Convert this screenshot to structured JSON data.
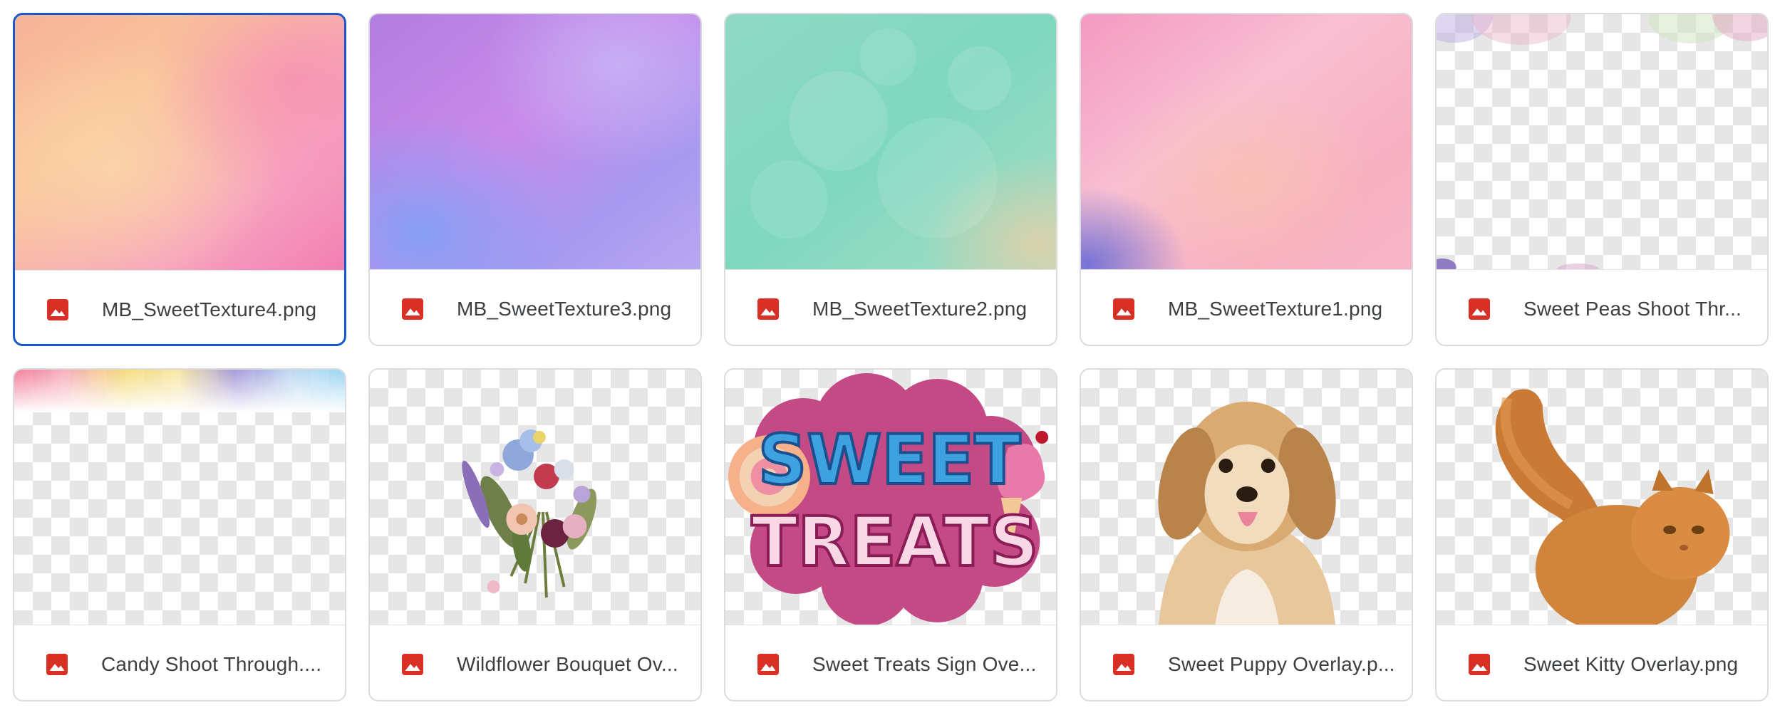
{
  "files": [
    {
      "name": "MB_SweetTexture4.png",
      "type_icon": "image-icon",
      "selected": true
    },
    {
      "name": "MB_SweetTexture3.png",
      "type_icon": "image-icon",
      "selected": false
    },
    {
      "name": "MB_SweetTexture2.png",
      "type_icon": "image-icon",
      "selected": false
    },
    {
      "name": "MB_SweetTexture1.png",
      "type_icon": "image-icon",
      "selected": false
    },
    {
      "name": "Sweet Peas Shoot Thr...",
      "type_icon": "image-icon",
      "selected": false
    },
    {
      "name": "Candy Shoot Through....",
      "type_icon": "image-icon",
      "selected": false
    },
    {
      "name": "Wildflower Bouquet Ov...",
      "type_icon": "image-icon",
      "selected": false
    },
    {
      "name": "Sweet Treats Sign Ove...",
      "type_icon": "image-icon",
      "selected": false
    },
    {
      "name": "Sweet Puppy Overlay.p...",
      "type_icon": "image-icon",
      "selected": false
    },
    {
      "name": "Sweet Kitty Overlay.png",
      "type_icon": "image-icon",
      "selected": false
    }
  ],
  "thumbnails": {
    "sign_line1": "SWEET",
    "sign_line2": "TREATS"
  },
  "colors": {
    "selected_border": "#1a57c9",
    "card_border": "#dadce0",
    "image_icon": "#d93025",
    "filename_text": "#3c4043"
  }
}
